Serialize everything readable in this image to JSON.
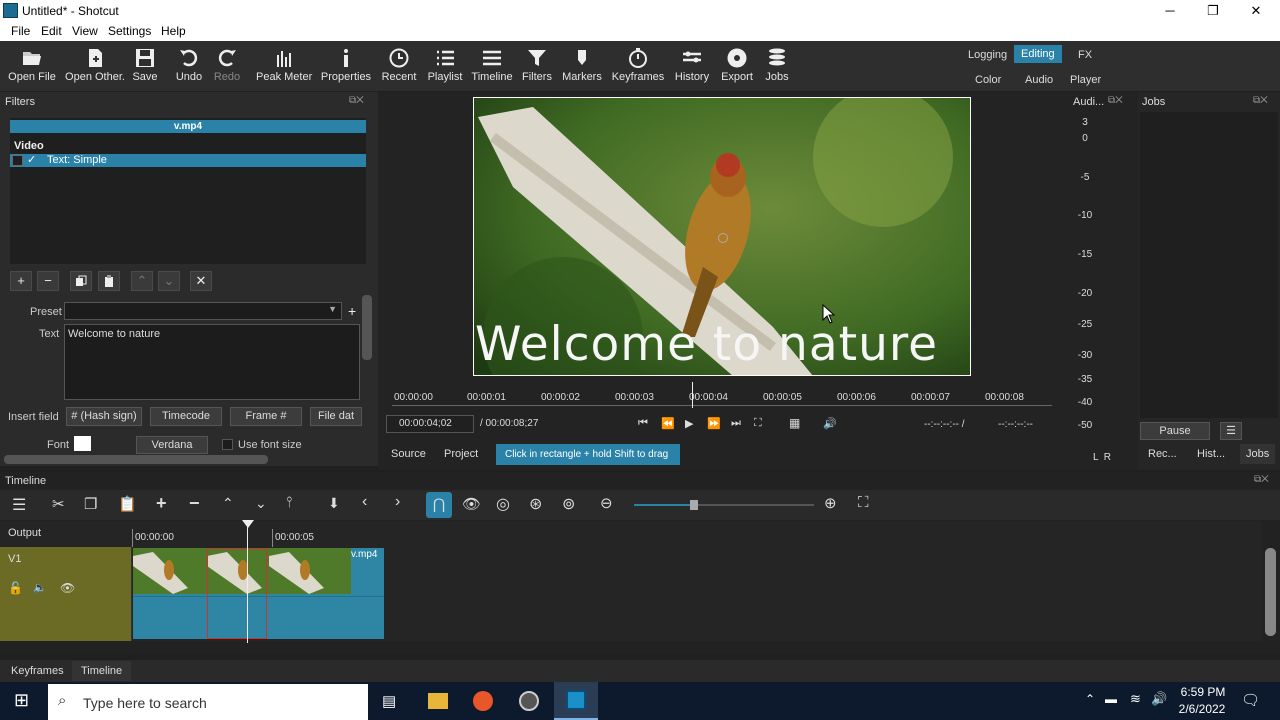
{
  "window": {
    "title": "Untitled* - Shotcut",
    "minimize": "─",
    "maximize": "❐",
    "close": "✕"
  },
  "menu": [
    "File",
    "Edit",
    "View",
    "Settings",
    "Help"
  ],
  "toolbar": [
    {
      "label": "Open File",
      "icon": "folder-open-icon"
    },
    {
      "label": "Open Other.",
      "icon": "open-other-icon"
    },
    {
      "label": "Save",
      "icon": "save-icon"
    },
    {
      "label": "Undo",
      "icon": "undo-icon"
    },
    {
      "label": "Redo",
      "icon": "redo-icon"
    },
    {
      "label": "Peak Meter",
      "icon": "peak-meter-icon"
    },
    {
      "label": "Properties",
      "icon": "info-icon"
    },
    {
      "label": "Recent",
      "icon": "clock-icon"
    },
    {
      "label": "Playlist",
      "icon": "playlist-icon"
    },
    {
      "label": "Timeline",
      "icon": "timeline-icon"
    },
    {
      "label": "Filters",
      "icon": "funnel-icon"
    },
    {
      "label": "Markers",
      "icon": "marker-icon"
    },
    {
      "label": "Keyframes",
      "icon": "stopwatch-icon"
    },
    {
      "label": "History",
      "icon": "history-icon"
    },
    {
      "label": "Export",
      "icon": "export-icon"
    },
    {
      "label": "Jobs",
      "icon": "jobs-icon"
    }
  ],
  "layouts": {
    "logging": "Logging",
    "editing": "Editing",
    "fx": "FX",
    "color": "Color",
    "audio": "Audio",
    "player": "Player"
  },
  "filters": {
    "title": "Filters",
    "file": "v.mp4",
    "section": "Video",
    "check": "✓",
    "item": "Text: Simple",
    "preset_label": "Preset",
    "text_label": "Text",
    "text_value": "Welcome to nature",
    "insert_label": "Insert field",
    "insert_buttons": [
      "# (Hash sign)",
      "Timecode",
      "Frame #",
      "File dat"
    ],
    "font_label": "Font",
    "font_name": "Verdana",
    "use_font_size": "Use font size"
  },
  "preview": {
    "overlay_text": "Welcome to nature",
    "ruler_ticks": [
      "00:00:00",
      "00:00:01",
      "00:00:02",
      "00:00:03",
      "00:00:04",
      "00:00:05",
      "00:00:06",
      "00:00:07",
      "00:00:08"
    ],
    "current_time": "00:00:04;02",
    "duration": "/ 00:00:08;27",
    "in_point": "--:--:--:-- /",
    "out_point": "--:--:--:--",
    "tab_source": "Source",
    "tab_project": "Project",
    "hint": "Click in rectangle + hold Shift to drag"
  },
  "audio": {
    "title": "Audi...",
    "scale": [
      "3",
      "0",
      "-5",
      "-10",
      "-15",
      "-20",
      "-25",
      "-30",
      "-35",
      "-40",
      "-50"
    ],
    "lr": "L  R"
  },
  "jobs": {
    "title": "Jobs",
    "pause": "Pause",
    "menu": "☰",
    "tabs": [
      "Rec...",
      "Hist...",
      "Jobs"
    ]
  },
  "timeline": {
    "title": "Timeline",
    "output": "Output",
    "track": "V1",
    "ticks": [
      "00:00:00",
      "00:00:05"
    ],
    "clip_name": "v.mp4"
  },
  "bottom_tabs": [
    "Keyframes",
    "Timeline"
  ],
  "taskbar": {
    "search_placeholder": "Type here to search",
    "time": "6:59 PM",
    "date": "2/6/2022"
  },
  "colors": {
    "accent": "#2a82a8",
    "track_header": "#6b6b25",
    "clip": "#2f86a4"
  }
}
